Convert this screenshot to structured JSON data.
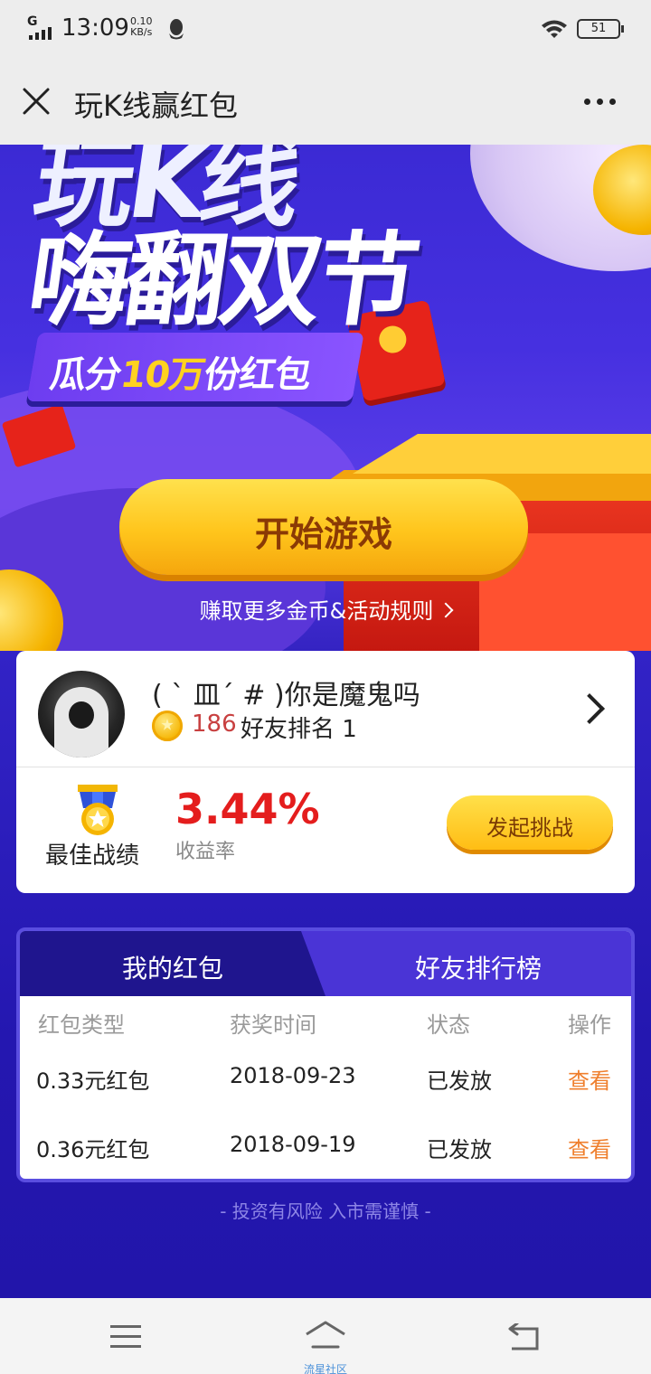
{
  "status_bar": {
    "network": "G",
    "time": "13:09",
    "speed_value": "0.10",
    "speed_unit": "KB/s",
    "battery": "51",
    "icons": [
      "signal-icon",
      "qq-icon",
      "wifi-icon",
      "battery-icon"
    ]
  },
  "title_bar": {
    "title": "玩K线赢红包",
    "icons": [
      "close-icon",
      "more-icon"
    ]
  },
  "banner": {
    "hero_line1": "玩K线",
    "hero_line2": "嗨翻双节",
    "subtitle_pre": "瓜分",
    "subtitle_highlight": "10万",
    "subtitle_post": "份红包",
    "start_button": "开始游戏",
    "rules_link": "赚取更多金币&活动规则"
  },
  "profile": {
    "username": "( ` 皿´ # )你是魔鬼吗",
    "coins": "186",
    "rank_label": "好友排名 1",
    "best_record_label": "最佳战绩",
    "yield_value": "3.44%",
    "yield_label": "收益率",
    "challenge_button": "发起挑战"
  },
  "panel": {
    "tabs": [
      {
        "label": "我的红包",
        "active": true
      },
      {
        "label": "好友排行榜",
        "active": false
      }
    ],
    "columns": [
      "红包类型",
      "获奖时间",
      "状态",
      "操作"
    ],
    "rows": [
      {
        "type": "0.33元红包",
        "date": "2018-09-23",
        "status": "已发放",
        "action": "查看"
      },
      {
        "type": "0.36元红包",
        "date": "2018-09-19",
        "status": "已发放",
        "action": "查看"
      }
    ]
  },
  "disclaimer": "- 投资有风险 入市需谨慎 -",
  "nav": {
    "caption": "流星社区",
    "icons": [
      "menu-icon",
      "home-icon",
      "back-icon"
    ]
  },
  "colors": {
    "brand_purple": "#2a1db0",
    "accent_yellow": "#ffc51c",
    "yield_red": "#e41d1d",
    "action_orange": "#ef7f2d"
  }
}
